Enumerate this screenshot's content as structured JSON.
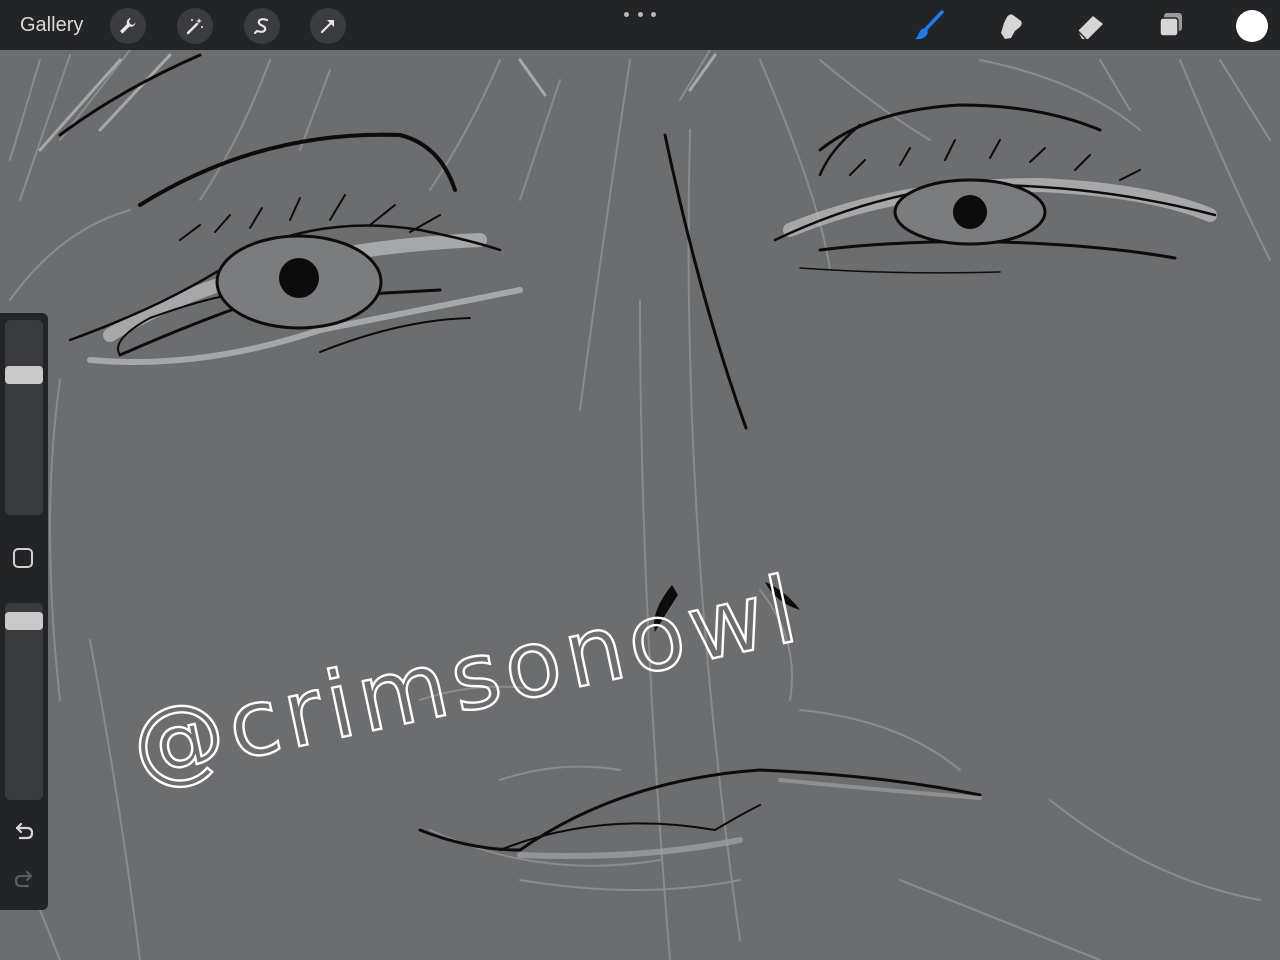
{
  "toolbar": {
    "gallery_label": "Gallery",
    "left_tools": [
      {
        "name": "actions",
        "icon": "wrench-icon"
      },
      {
        "name": "adjustments",
        "icon": "magic-wand-icon"
      },
      {
        "name": "selection",
        "icon": "selection-s-icon"
      },
      {
        "name": "transform",
        "icon": "arrow-cursor-icon"
      }
    ],
    "more_icon": "more-dots-icon",
    "right_tools": [
      {
        "name": "brush",
        "icon": "brush-icon",
        "active": true
      },
      {
        "name": "smudge",
        "icon": "smudge-finger-icon",
        "active": false
      },
      {
        "name": "eraser",
        "icon": "eraser-icon",
        "active": false
      },
      {
        "name": "layers",
        "icon": "layers-icon",
        "active": false
      }
    ],
    "active_color": "#ffffff",
    "accent_color": "#1a7cf0"
  },
  "sidebar": {
    "brush_size_level": 0.74,
    "brush_opacity_level": 0.95,
    "modify_icon": "square-modify-icon",
    "undo_icon": "undo-icon",
    "redo_icon": "redo-icon"
  },
  "canvas": {
    "signature_text": "@crimsonowl",
    "background_color": "#6b6d6e",
    "ink_color": "#0c0c0c"
  }
}
